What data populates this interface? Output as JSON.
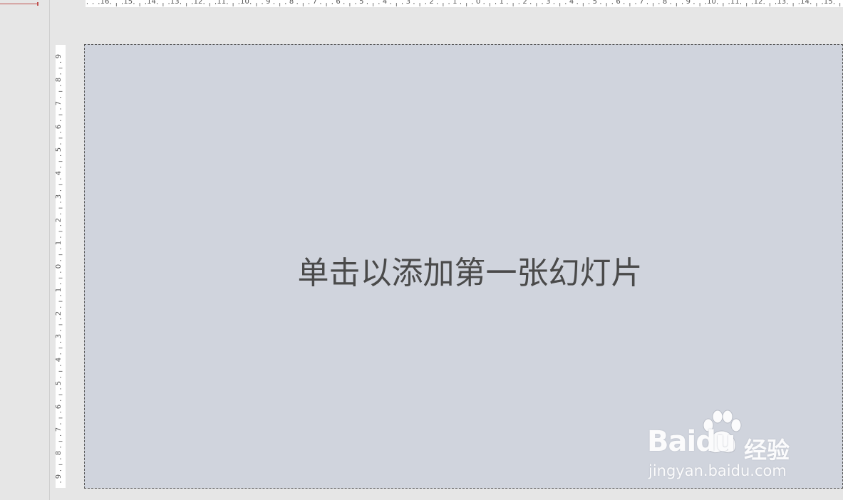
{
  "slide": {
    "placeholder_text": "单击以添加第一张幻灯片"
  },
  "ruler_horizontal": {
    "labels": [
      "16",
      "15",
      "14",
      "13",
      "12",
      "11",
      "10",
      "9",
      "8",
      "7",
      "6",
      "5",
      "4",
      "3",
      "2",
      "1",
      "0",
      "1",
      "2",
      "3",
      "4",
      "5",
      "6",
      "7",
      "8",
      "9",
      "10",
      "11",
      "12",
      "13",
      "14",
      "15"
    ]
  },
  "ruler_vertical": {
    "labels": [
      "9",
      "8",
      "7",
      "6",
      "5",
      "4",
      "3",
      "2",
      "1",
      "0",
      "1",
      "2",
      "3",
      "4",
      "5",
      "6",
      "7",
      "8",
      "9"
    ]
  },
  "watermark": {
    "logo_text": "Baidu",
    "product_text": "经验",
    "url_text": "jingyan.baidu.com"
  },
  "colors": {
    "slide_bg": "#d0d4dd",
    "app_bg": "#e6e6e6",
    "insert_marker": "#c0504d"
  }
}
